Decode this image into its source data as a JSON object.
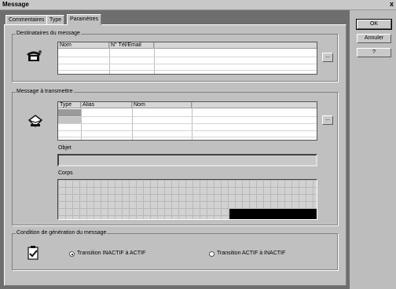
{
  "window": {
    "title": "Message",
    "close_glyph": "x"
  },
  "tabs": [
    {
      "label": "Commentaires",
      "active": false
    },
    {
      "label": "Type",
      "active": false
    },
    {
      "label": "Paramètres",
      "active": true
    }
  ],
  "buttons": {
    "ok": "OK",
    "cancel": "Annuler",
    "help": "?"
  },
  "recipients": {
    "legend": "Destinataires du message",
    "columns": [
      "Nom",
      "N° Tél/Email"
    ],
    "browse": "..."
  },
  "message": {
    "legend": "Message à transmettre",
    "columns": [
      "Type",
      "Alias",
      "Nom"
    ],
    "browse": "...",
    "object_label": "Objet",
    "body_label": "Corps"
  },
  "condition": {
    "legend": "Condition de génération du message",
    "options": [
      {
        "label": "Transition INACTIF à ACTIF",
        "selected": true
      },
      {
        "label": "Transition ACTIF à INACTIF",
        "selected": false
      }
    ]
  }
}
